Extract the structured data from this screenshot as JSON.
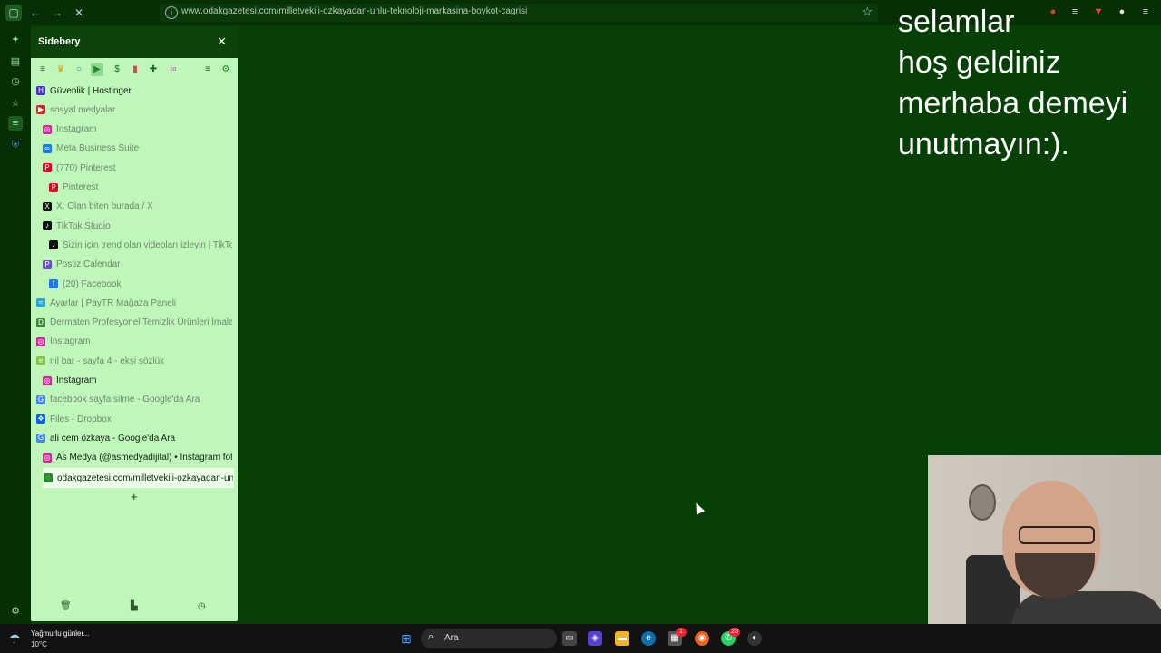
{
  "browser": {
    "url": "www.odakgazetesi.com/milletvekili-ozkayadan-unlu-teknoloji-markasina-boykot-cagrisi",
    "nav_icons": [
      "sidebar-icon",
      "back-icon",
      "forward-icon",
      "stop-icon"
    ]
  },
  "sidebery": {
    "title": "Sidebery",
    "close_glyph": "✕",
    "panel_count": "21",
    "tabs": [
      {
        "label": "Güvenlik | Hostinger",
        "indent": 0,
        "strong": true,
        "fav": "H",
        "fav_color": "#4b2bd1"
      },
      {
        "label": "sosyal medyalar",
        "indent": 0,
        "strong": false,
        "fav": "▶",
        "fav_color": "#e02020"
      },
      {
        "label": "Instagram",
        "indent": 1,
        "strong": false,
        "fav": "◎",
        "fav_color": "#d6249f"
      },
      {
        "label": "Meta Business Suite",
        "indent": 1,
        "strong": false,
        "fav": "∞",
        "fav_color": "#1877f2"
      },
      {
        "label": "(770) Pinterest",
        "indent": 1,
        "strong": false,
        "fav": "P",
        "fav_color": "#e60023"
      },
      {
        "label": "Pinterest",
        "indent": 2,
        "strong": false,
        "fav": "P",
        "fav_color": "#e60023"
      },
      {
        "label": "X. Olan biten burada / X",
        "indent": 1,
        "strong": false,
        "fav": "X",
        "fav_color": "#111111"
      },
      {
        "label": "TikTok Studio",
        "indent": 1,
        "strong": false,
        "fav": "♪",
        "fav_color": "#111111"
      },
      {
        "label": "Sizin için trend olan videoları izleyin | TikTok",
        "indent": 2,
        "strong": false,
        "fav": "♪",
        "fav_color": "#111111"
      },
      {
        "label": "Postiz Calendar",
        "indent": 1,
        "strong": false,
        "fav": "P",
        "fav_color": "#6a4bd1"
      },
      {
        "label": "(20) Facebook",
        "indent": 2,
        "strong": false,
        "fav": "f",
        "fav_color": "#1877f2"
      },
      {
        "label": "Ayarlar | PayTR Mağaza Paneli",
        "indent": 0,
        "strong": false,
        "fav": "≈",
        "fav_color": "#2aa5d8"
      },
      {
        "label": "Dermaten Profesyonel Temizlik Ürünleri İmalatı",
        "indent": 0,
        "strong": false,
        "fav": "D",
        "fav_color": "#3a8a3a"
      },
      {
        "label": "Instagram",
        "indent": 0,
        "strong": false,
        "fav": "◎",
        "fav_color": "#d6249f"
      },
      {
        "label": "nil bar - sayfa 4 - ekşi sözlük",
        "indent": 0,
        "strong": false,
        "fav": "e",
        "fav_color": "#81c14b"
      },
      {
        "label": "Instagram",
        "indent": 1,
        "strong": true,
        "fav": "◎",
        "fav_color": "#d6249f"
      },
      {
        "label": "facebook sayfa silme - Google'da Ara",
        "indent": 0,
        "strong": false,
        "fav": "G",
        "fav_color": "#4285f4"
      },
      {
        "label": "Files - Dropbox",
        "indent": 0,
        "strong": false,
        "fav": "❖",
        "fav_color": "#0061ff"
      },
      {
        "label": "ali cem özkaya - Google'da Ara",
        "indent": 0,
        "strong": true,
        "fav": "G",
        "fav_color": "#4285f4"
      },
      {
        "label": "As Medya (@asmedyadijital) • Instagram fotoğraf",
        "indent": 1,
        "strong": true,
        "fav": "◎",
        "fav_color": "#d6249f"
      },
      {
        "label": "odakgazetesi.com/milletvekili-ozkayadan-unlu",
        "indent": 1,
        "strong": true,
        "current": true,
        "fav": "◌",
        "fav_color": "#2a8a2a"
      }
    ],
    "add_glyph": "+"
  },
  "overlay_text": [
    "selamlar",
    "hoş geldiniz",
    "merhaba demeyi",
    "unutmayın:)."
  ],
  "taskbar": {
    "weather_line1": "Yağmurlu günler...",
    "weather_line2": "10°C",
    "search_placeholder": "Ara",
    "whatsapp_badge": "23",
    "store_badge": "1"
  }
}
